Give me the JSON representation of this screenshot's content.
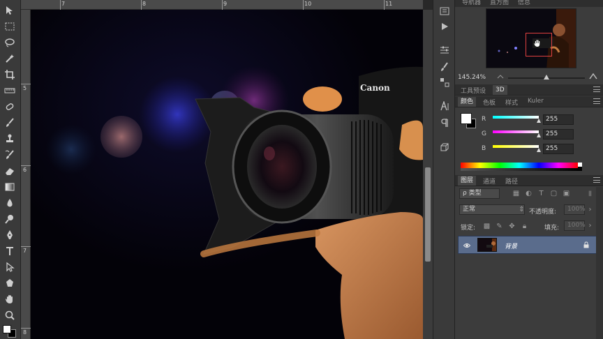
{
  "rulers": {
    "top": [
      "7",
      "8",
      "9",
      "10",
      "11"
    ],
    "left": [
      "5",
      "6",
      "7",
      "8"
    ]
  },
  "navigator": {
    "tabs": [
      "导航器",
      "直方图",
      "信息"
    ],
    "zoom": "145.24%"
  },
  "tool_presets": {
    "tabs": [
      "工具预设",
      "3D"
    ]
  },
  "color_panel": {
    "tabs": [
      "颜色",
      "色板",
      "样式",
      "Kuler"
    ],
    "r_label": "R",
    "g_label": "G",
    "b_label": "B",
    "r": "255",
    "g": "255",
    "b": "255",
    "r_fraction": 1.0,
    "g_fraction": 1.0,
    "b_fraction": 1.0
  },
  "layers_panel": {
    "tabs": [
      "图层",
      "通道",
      "路径"
    ],
    "filter_label": "ρ 类型",
    "blend_mode": "正常",
    "opacity_label": "不透明度:",
    "opacity_value": "100%",
    "lock_label": "锁定:",
    "fill_label": "填充:",
    "fill_value": "100%",
    "layers": [
      {
        "name": "背景",
        "visible": true,
        "locked": true
      }
    ]
  },
  "camera_brand": "Canon",
  "colors": {
    "accent_selected_layer": "#5a6c8c",
    "nav_view_box": "#e04040"
  }
}
